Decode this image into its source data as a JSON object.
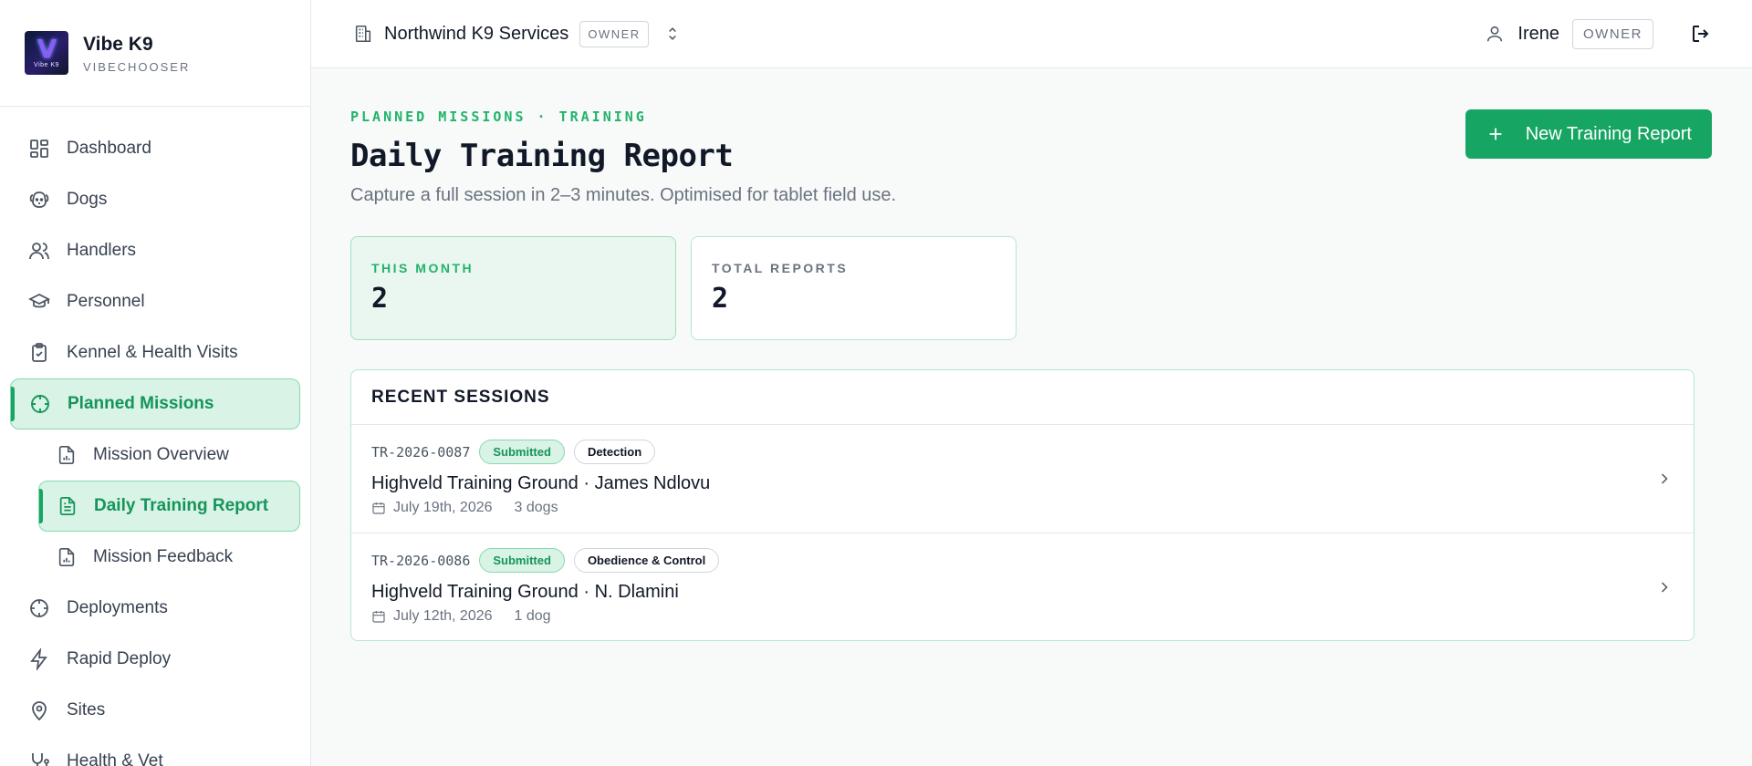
{
  "brand": {
    "name": "Vibe K9",
    "sub": "VIBECHOOSER",
    "logo_text": "Vibe K9"
  },
  "sidebar": {
    "items": [
      {
        "label": "Dashboard",
        "icon": "dashboard-icon"
      },
      {
        "label": "Dogs",
        "icon": "dog-icon"
      },
      {
        "label": "Handlers",
        "icon": "users-icon"
      },
      {
        "label": "Personnel",
        "icon": "graduation-cap-icon"
      },
      {
        "label": "Kennel & Health Visits",
        "icon": "clipboard-check-icon"
      },
      {
        "label": "Planned Missions",
        "icon": "crosshair-icon",
        "active": true
      },
      {
        "label": "Mission Overview",
        "icon": "file-chart-icon"
      },
      {
        "label": "Daily Training Report",
        "icon": "file-text-icon",
        "active": true
      },
      {
        "label": "Mission Feedback",
        "icon": "file-chart-icon"
      },
      {
        "label": "Deployments",
        "icon": "crosshair-icon"
      },
      {
        "label": "Rapid Deploy",
        "icon": "lightning-icon"
      },
      {
        "label": "Sites",
        "icon": "map-pin-icon"
      },
      {
        "label": "Health & Vet",
        "icon": "stethoscope-icon"
      }
    ]
  },
  "topbar": {
    "org_name": "Northwind K9 Services",
    "org_role": "OWNER",
    "user_name": "Irene",
    "user_role": "OWNER"
  },
  "page": {
    "eyebrow": "PLANNED MISSIONS · TRAINING",
    "title": "Daily Training Report",
    "subtitle": "Capture a full session in 2–3 minutes. Optimised for tablet field use.",
    "primary_action": "New Training Report"
  },
  "stats": [
    {
      "label": "THIS MONTH",
      "value": "2"
    },
    {
      "label": "TOTAL REPORTS",
      "value": "2"
    }
  ],
  "recent": {
    "heading": "RECENT SESSIONS",
    "sessions": [
      {
        "id": "TR-2026-0087",
        "status": "Submitted",
        "category": "Detection",
        "title": "Highveld Training Ground · James Ndlovu",
        "date": "July 19th, 2026",
        "dogs": "3 dogs"
      },
      {
        "id": "TR-2026-0086",
        "status": "Submitted",
        "category": "Obedience & Control",
        "title": "Highveld Training Ground · N. Dlamini",
        "date": "July 12th, 2026",
        "dogs": "1 dog"
      }
    ]
  },
  "colors": {
    "accent": "#16a563",
    "accent_bg": "#d9f3e6",
    "border_accent": "#86d9ad"
  }
}
